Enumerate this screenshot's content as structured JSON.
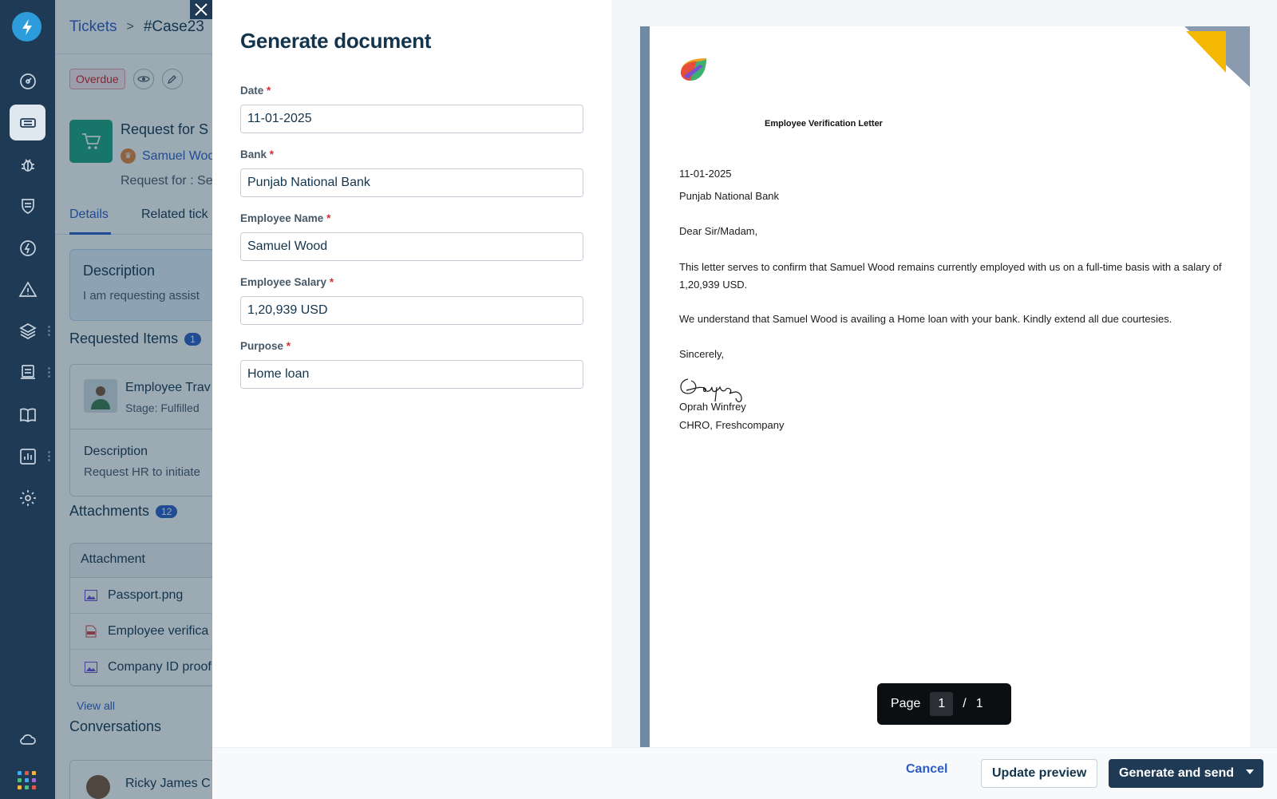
{
  "nav": {
    "icons": [
      "dashboard-icon",
      "tickets-icon",
      "bug-icon",
      "shield-icon",
      "bolt-icon",
      "alert-icon",
      "layers-icon",
      "assets-icon",
      "book-icon",
      "analytics-icon",
      "settings-icon",
      "cloud-icon",
      "apps-icon"
    ],
    "active": "tickets-icon"
  },
  "ticket": {
    "breadcrumb_link": "Tickets",
    "breadcrumb_sep": ">",
    "case_id": "#Case23",
    "overdue_badge": "Overdue",
    "request_title": "Request for S",
    "requester": "Samuel Woo",
    "request_for": "Request for : Se",
    "tabs": [
      "Details",
      "Related tick"
    ],
    "description_heading": "Description",
    "description_text": "I am requesting assist",
    "requested_items_heading": "Requested Items",
    "requested_items_count": "1",
    "item_name": "Employee Trav",
    "item_stage": "Stage: Fulfilled",
    "item_desc_heading": "Description",
    "item_desc_text": "Request HR to initiate",
    "attachments_heading": "Attachments",
    "attachments_count": "12",
    "attachment_col": "Attachment",
    "attachments": [
      "Passport.png",
      "Employee verifica",
      "Company ID proof"
    ],
    "view_all": "View all",
    "conversations_heading": "Conversations",
    "conversation_author": "Ricky James C"
  },
  "modal": {
    "title": "Generate document",
    "fields": [
      {
        "label": "Date",
        "value": "11-01-2025"
      },
      {
        "label": "Bank",
        "value": "Punjab National Bank"
      },
      {
        "label": "Employee Name",
        "value": "Samuel Wood"
      },
      {
        "label": "Employee Salary",
        "value": "1,20,939 USD"
      },
      {
        "label": "Purpose",
        "value": "Home loan"
      }
    ],
    "required_mark": "*"
  },
  "letter": {
    "title": "Employee Verification Letter",
    "date": "11-01-2025",
    "bank": "Punjab National Bank",
    "salutation": "Dear Sir/Madam,",
    "para1": "This letter serves to confirm that Samuel Wood remains currently employed with us on a full-time basis with a salary of 1,20,939 USD.",
    "para2": "We understand that Samuel Wood is availing a Home loan with your bank. Kindly extend all due courtesies.",
    "closing": "Sincerely,",
    "signatory": "Oprah Winfrey",
    "signatory_title": "CHRO, Freshcompany"
  },
  "pager": {
    "label": "Page",
    "current": "1",
    "sep": "/",
    "total": "1"
  },
  "footer": {
    "cancel": "Cancel",
    "update_preview": "Update preview",
    "generate_send": "Generate and send"
  },
  "colors": {
    "nav_bg": "#1f3a55",
    "link": "#2c5cc5",
    "primary_button": "#1f3a55",
    "required": "#d72d30"
  }
}
